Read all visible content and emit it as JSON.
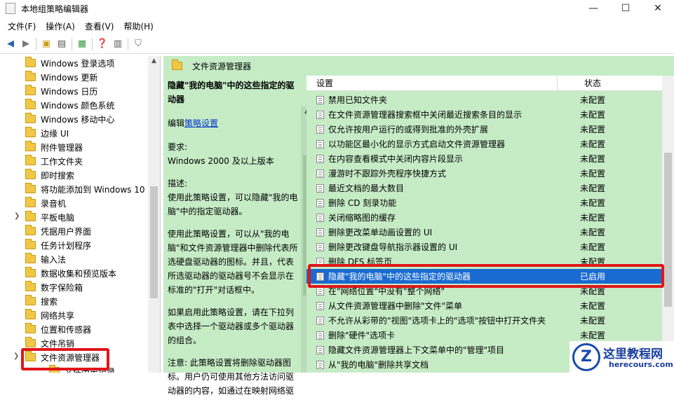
{
  "window": {
    "title": "本地组策略编辑器",
    "minimize": "—",
    "maximize": "☐",
    "close": "✕"
  },
  "menu": [
    "文件(F)",
    "操作(A)",
    "查看(V)",
    "帮助(H)"
  ],
  "tree": {
    "items": [
      {
        "label": "Windows 登录选项"
      },
      {
        "label": "Windows 更新"
      },
      {
        "label": "Windows 日历"
      },
      {
        "label": "Windows 颜色系统"
      },
      {
        "label": "Windows 移动中心"
      },
      {
        "label": "边缘 UI"
      },
      {
        "label": "附件管理器"
      },
      {
        "label": "工作文件夹"
      },
      {
        "label": "即时搜索"
      },
      {
        "label": "将功能添加到 Windows 10"
      },
      {
        "label": "录音机"
      },
      {
        "label": "平板电脑"
      },
      {
        "label": "凭据用户界面"
      },
      {
        "label": "任务计划程序"
      },
      {
        "label": "输入法"
      },
      {
        "label": "数据收集和预览版本"
      },
      {
        "label": "数字保险箱"
      },
      {
        "label": "搜索"
      },
      {
        "label": "网络共享"
      },
      {
        "label": "位置和传感器"
      },
      {
        "label": "文件吊销"
      },
      {
        "label": "文件资源管理器"
      },
      {
        "label": "文件历史记录"
      }
    ]
  },
  "right": {
    "folder_title": "文件资源管理器",
    "desc": {
      "heading": "隐藏\"我的电脑\"中的这些指定的驱动器",
      "edit_prefix": "编辑",
      "edit_link": "策略设置",
      "req_label": "要求:",
      "req_value": "Windows 2000 及以上版本",
      "desc_label": "描述:",
      "p1": "使用此策略设置，可以隐藏\"我的电脑\"中的指定驱动器。",
      "p2": "使用此策略设置，可以从\"我的电脑\"和文件资源管理器中删除代表所选硬盘驱动器的图标。并且，代表所选驱动器的驱动器号不会显示在标准的\"打开\"对话框中。",
      "p3": "如果启用此策略设置，请在下拉列表中选择一个驱动器或多个驱动器的组合。",
      "p4": "注意: 此策略设置将删除驱动器图标。用户仍可使用其他方法访问驱动器的内容，如通过在映射网络驱"
    },
    "list": {
      "col_setting": "设置",
      "col_state": "状态",
      "rows": [
        {
          "name": "禁用已知文件夹",
          "state": "未配置"
        },
        {
          "name": "在文件资源管理器搜索框中关闭最近搜索条目的显示",
          "state": "未配置"
        },
        {
          "name": "仅允许按用户运行的或得到批准的外壳扩展",
          "state": "未配置"
        },
        {
          "name": "以功能区最小化的显示方式启动文件资源管理器",
          "state": "未配置"
        },
        {
          "name": "在内容查看模式中关闭内容片段显示",
          "state": "未配置"
        },
        {
          "name": "漫游时不跟踪外壳程序快捷方式",
          "state": "未配置"
        },
        {
          "name": "最近文档的最大数目",
          "state": "未配置"
        },
        {
          "name": "删除 CD 刻录功能",
          "state": "未配置"
        },
        {
          "name": "关闭缩略图的缓存",
          "state": "未配置"
        },
        {
          "name": "删除更改菜单动画设置的 UI",
          "state": "未配置"
        },
        {
          "name": "删除更改键盘导航指示器设置的 UI",
          "state": "未配置"
        },
        {
          "name": "删除 DFS 标签页",
          "state": "未配置"
        },
        {
          "name": "隐藏\"我的电脑\"中的这些指定的驱动器",
          "state": "已启用"
        },
        {
          "name": "在\"网络位置\"中没有\"整个网络\"",
          "state": "未配置"
        },
        {
          "name": "从文件资源管理器中删除\"文件\"菜单",
          "state": "未配置"
        },
        {
          "name": "不允许从彩带的\"视图\"选项卡上的\"选项\"按钮中打开文件夹",
          "state": "未配置"
        },
        {
          "name": "删除\"硬件\"选项卡",
          "state": "未配置"
        },
        {
          "name": "隐藏文件资源管理器上下文菜单中的\"管理\"项目",
          "state": "未配置"
        },
        {
          "name": "从\"我的电脑\"删除共享文档",
          "state": "未配置"
        }
      ]
    }
  },
  "logo": {
    "mark": "Z",
    "cn": "这里教程网",
    "url": "herecours.com"
  }
}
